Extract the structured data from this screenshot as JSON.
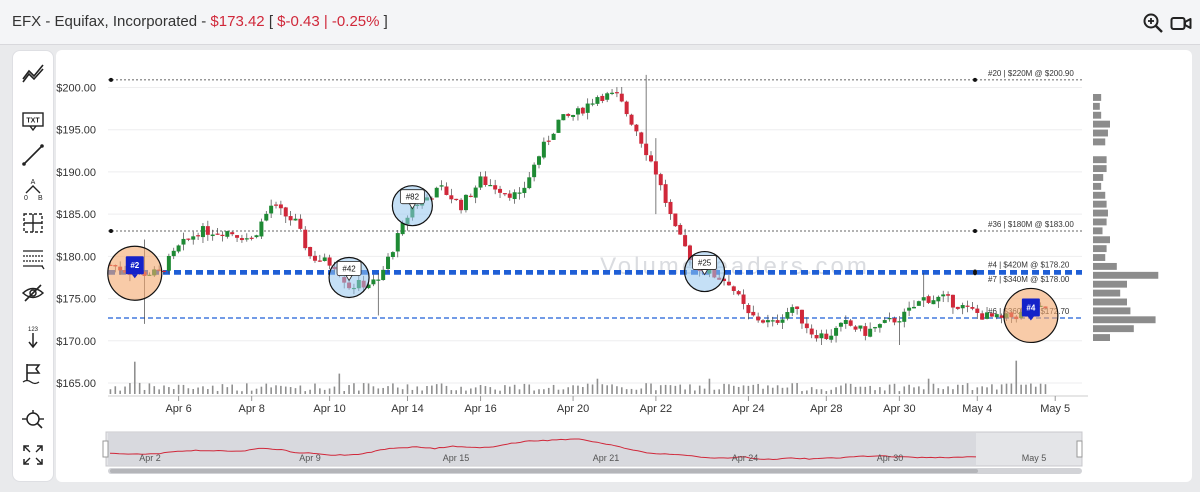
{
  "header": {
    "ticker_name": "EFX - Equifax, Incorporated - ",
    "price": "$173.42",
    "bracket_open": " [ ",
    "change": "$-0.43 | -0.25%",
    "bracket_close": " ]"
  },
  "toolbar": {
    "icons": [
      "trend-lines-icon",
      "text-icon",
      "line-icon",
      "pattern-icon",
      "crosshair-icon",
      "fib-icon",
      "hide-icon",
      "measure-icon",
      "flag-icon",
      "zoom-target-icon",
      "fullscreen-icon"
    ],
    "labels": {
      "txt": "TXT",
      "measure": "123"
    }
  },
  "watermark": "VolumeLeaders.com",
  "colors": {
    "up": "#1e8a34",
    "down": "#d0283a",
    "blue_dash": "#1f5fd6",
    "volume": "#8f8f8f"
  },
  "chart_data": {
    "type": "candlestick",
    "ylim": [
      164.0,
      201.5
    ],
    "y_ticks": [
      "$200.00",
      "$195.00",
      "$190.00",
      "$185.00",
      "$180.00",
      "$175.00",
      "$170.00",
      "$165.00"
    ],
    "y_tick_values": [
      200,
      195,
      190,
      185,
      180,
      175,
      170,
      165
    ],
    "x_ticks": [
      "Apr 6",
      "Apr 8",
      "Apr 10",
      "Apr 14",
      "Apr 16",
      "Apr 20",
      "Apr 22",
      "Apr 24",
      "Apr 28",
      "Apr 30",
      "May 4",
      "May 5"
    ],
    "x_tick_index": [
      14,
      29,
      45,
      61,
      76,
      95,
      112,
      131,
      147,
      162,
      178,
      194
    ],
    "levels": [
      {
        "label": "#20 | $220M @ $200.90",
        "price": 200.9,
        "style": "black-dotted"
      },
      {
        "label": "#36 | $180M @ $183.00",
        "price": 183.0,
        "style": "black-dotted"
      },
      {
        "label": "#4 | $420M @ $178.20",
        "price": 178.2,
        "style": "blue-bold-dashed"
      },
      {
        "label": "#7 | $340M @ $178.00",
        "price": 178.0,
        "style": "blue-bold-dashed"
      },
      {
        "label": "#6 | $360M @ $172.70",
        "price": 172.7,
        "style": "blue-dashed"
      }
    ],
    "trade_markers": [
      {
        "label": "#2",
        "index": 5,
        "price": 178.0,
        "kind": "orange-circle-blue-flag"
      },
      {
        "label": "#42",
        "index": 49,
        "price": 177.5,
        "kind": "blue-circle-bubble"
      },
      {
        "label": "#82",
        "index": 62,
        "price": 186.0,
        "kind": "blue-circle-bubble"
      },
      {
        "label": "#25",
        "index": 122,
        "price": 178.2,
        "kind": "blue-circle-bubble"
      },
      {
        "label": "#4",
        "index": 189,
        "price": 173.0,
        "kind": "orange-circle-blue-flag"
      }
    ],
    "volume_profile": [
      0.12,
      0.1,
      0.12,
      0.25,
      0.22,
      0.18,
      0.0,
      0.2,
      0.2,
      0.15,
      0.12,
      0.18,
      0.2,
      0.22,
      0.2,
      0.14,
      0.25,
      0.2,
      0.18,
      0.35,
      0.96,
      0.5,
      0.4,
      0.5,
      0.55,
      0.92,
      0.6,
      0.25
    ],
    "navigator": {
      "labels": [
        "Apr 2",
        "Apr 9",
        "Apr 15",
        "Apr 21",
        "Apr 24",
        "Apr 30",
        "May 5"
      ]
    }
  }
}
